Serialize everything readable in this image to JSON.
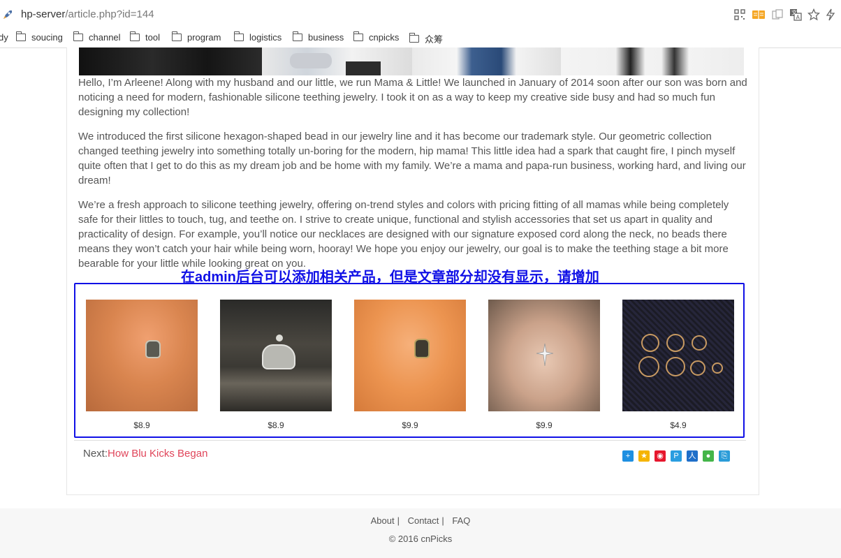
{
  "browser": {
    "url_host": "hp-server",
    "url_path": "/article.php?id=144"
  },
  "bookmarks": {
    "partial_first": "dy",
    "items": [
      "soucing",
      "channel",
      "tool",
      "program",
      "logistics",
      "business",
      "cnpicks",
      "众筹"
    ]
  },
  "article": {
    "paragraphs": [
      "Hello, I’m Arleene! Along with my husband and our little, we run Mama & Little! We launched in January of 2014 soon after our son was born and noticing a need for modern, fashionable silicone teething jewelry. I took it on as a way to keep my creative side busy and had so much fun designing my collection!",
      "We introduced the first silicone hexagon-shaped bead in our jewelry line and it has become our trademark style. Our geometric collection changed teething jewelry into something totally un-boring for the modern, hip mama! This little idea had a spark that caught fire, I pinch myself quite often that I get to do this as my dream job and be home with my family. We’re a mama and papa-run business, working hard, and living our dream!",
      "We’re a fresh approach to silicone teething jewelry, offering on-trend styles and colors with pricing fitting of all mamas while being completely safe for their littles to touch, tug, and teethe on. I strive to create unique, functional and stylish accessories that set us apart in quality and practicality of design. For example, you’ll notice our necklaces are designed with our signature exposed cord along the neck, no beads there means they won’t catch your hair while being worn, hooray! We hope you enjoy our jewelry, our goal is to make the teething stage a bit more bearable for your little while looking great on you."
    ]
  },
  "annotation": "在admin后台可以添加相关产品，但是文章部分却没有显示，请增加",
  "products": [
    {
      "price": "$8.9",
      "image": "skull-nose-stud"
    },
    {
      "price": "$8.9",
      "image": "elephant-stud"
    },
    {
      "price": "$9.9",
      "image": "skull-nose-stud-gold"
    },
    {
      "price": "$9.9",
      "image": "star-stud"
    },
    {
      "price": "$4.9",
      "image": "gold-hoops"
    }
  ],
  "next": {
    "label": "Next:",
    "link": "How Blu Kicks Began"
  },
  "share_icons": [
    "plus-icon",
    "qzone-icon",
    "weibo-icon",
    "tencent-icon",
    "renren-icon",
    "wechat-icon",
    "copy-icon"
  ],
  "footer": {
    "about": "About",
    "contact": "Contact",
    "faq": "FAQ",
    "sep": "|",
    "copyright": "© 2016 cnPicks"
  }
}
